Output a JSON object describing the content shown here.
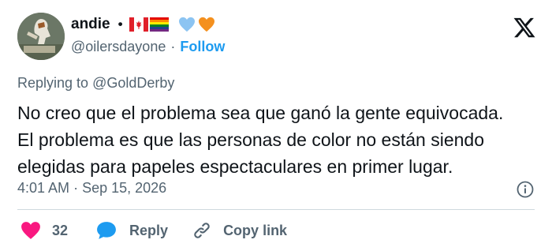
{
  "author": {
    "display_name": "andie",
    "separator": "•",
    "handle": "@oilersdayone",
    "handle_separator": "·",
    "follow_label": "Follow",
    "avatar_icon": "hockey-player-avatar",
    "emojis": [
      "canada-flag",
      "rainbow-flag",
      "blue-heart",
      "orange-heart"
    ]
  },
  "platform_icon": "x-logo-icon",
  "replying": {
    "prefix": "Replying to",
    "mention": "@GoldDerby"
  },
  "tweet": {
    "line1": "No creo que el problema sea que ganó la gente equivocada.",
    "line2": "El problema es que las personas de color no están siendo",
    "line3": "elegidas para papeles espectaculares en primer lugar."
  },
  "meta": {
    "time": "4:01 AM",
    "separator": "·",
    "date": "Sep 15, 2026"
  },
  "actions": {
    "like_count": "32",
    "reply_label": "Reply",
    "copy_label": "Copy link"
  },
  "colors": {
    "accent": "#1d9bf0",
    "like": "#f91880",
    "muted": "#536471",
    "text": "#0f1419"
  }
}
